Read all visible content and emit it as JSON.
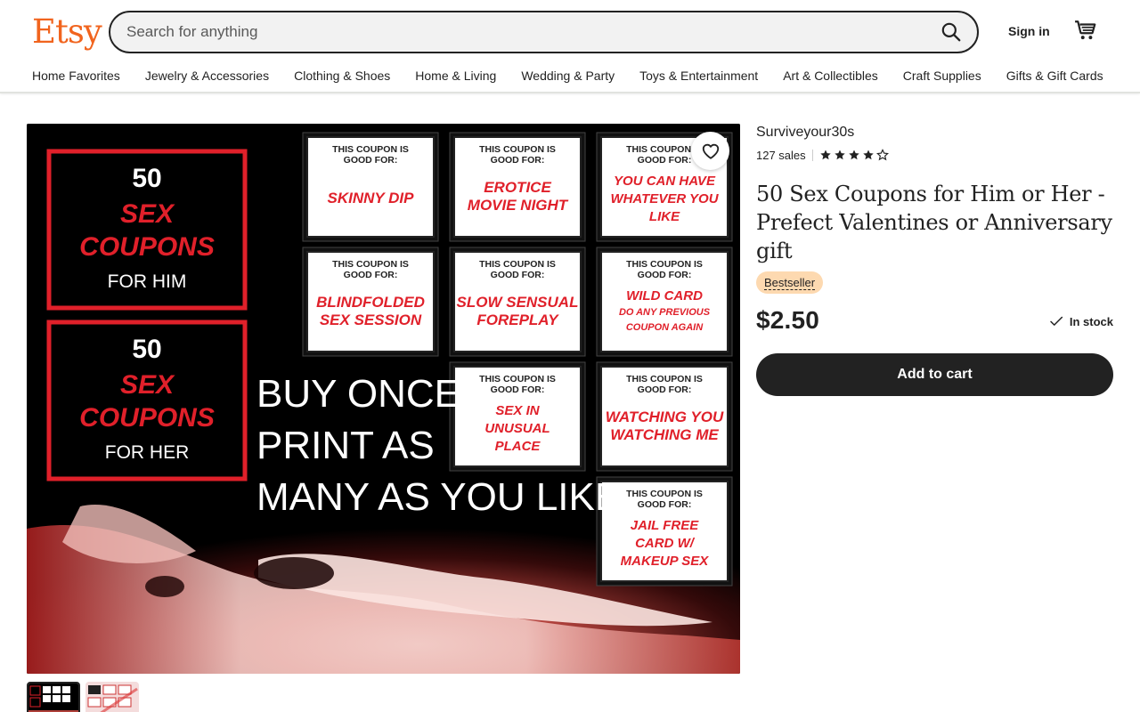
{
  "header": {
    "logo": "Etsy",
    "search_placeholder": "Search for anything",
    "sign_in": "Sign in"
  },
  "categories": [
    "Home Favorites",
    "Jewelry & Accessories",
    "Clothing & Shoes",
    "Home & Living",
    "Wedding & Party",
    "Toys & Entertainment",
    "Art & Collectibles",
    "Craft Supplies",
    "Gifts & Gift Cards"
  ],
  "listing": {
    "shop_name": "Surviveyour30s",
    "sales": "127 sales",
    "rating": 4,
    "rating_max": 5,
    "title": "50 Sex Coupons for Him or Her - Prefect Valentines or Anniversary gift",
    "badge": "Bestseller",
    "price": "$2.50",
    "stock": "In stock",
    "add_to_cart": "Add to cart"
  },
  "image": {
    "covers": [
      {
        "count": "50",
        "line1": "SEX",
        "line2": "COUPONS",
        "for": "FOR HIM"
      },
      {
        "count": "50",
        "line1": "SEX",
        "line2": "COUPONS",
        "for": "FOR HER"
      }
    ],
    "coupon_header_1": "THIS COUPON IS",
    "coupon_header_2": "GOOD FOR:",
    "coupons": [
      {
        "l1": "SKINNY DIP",
        "l2": "",
        "l3": ""
      },
      {
        "l1": "EROTICE",
        "l2": "MOVIE NIGHT",
        "l3": ""
      },
      {
        "l1": "YOU CAN HAVE",
        "l2": "WHATEVER YOU",
        "l3": "LIKE"
      },
      {
        "l1": "BLINDFOLDED",
        "l2": "SEX SESSION",
        "l3": ""
      },
      {
        "l1": "SLOW SENSUAL",
        "l2": "FOREPLAY",
        "l3": ""
      },
      {
        "l1": "WILD CARD",
        "l2": "DO ANY PREVIOUS",
        "l3": "COUPON AGAIN"
      },
      {
        "l1": "SEX IN",
        "l2": "UNUSUAL",
        "l3": "PLACE"
      },
      {
        "l1": "WATCHING YOU",
        "l2": "WATCHING ME",
        "l3": ""
      },
      {
        "l1": "JAIL FREE",
        "l2": "CARD W/",
        "l3": "MAKEUP SEX"
      }
    ],
    "slogan": [
      "BUY ONCE",
      "PRINT AS",
      "MANY AS YOU LIKE"
    ]
  },
  "colors": {
    "brand": "#F1641E",
    "badge_bg": "#FDD9B0",
    "coupon_red": "#E0202A"
  },
  "icons": [
    "search-icon",
    "cart-icon",
    "heart-icon",
    "star-icon",
    "checkmark-icon"
  ]
}
